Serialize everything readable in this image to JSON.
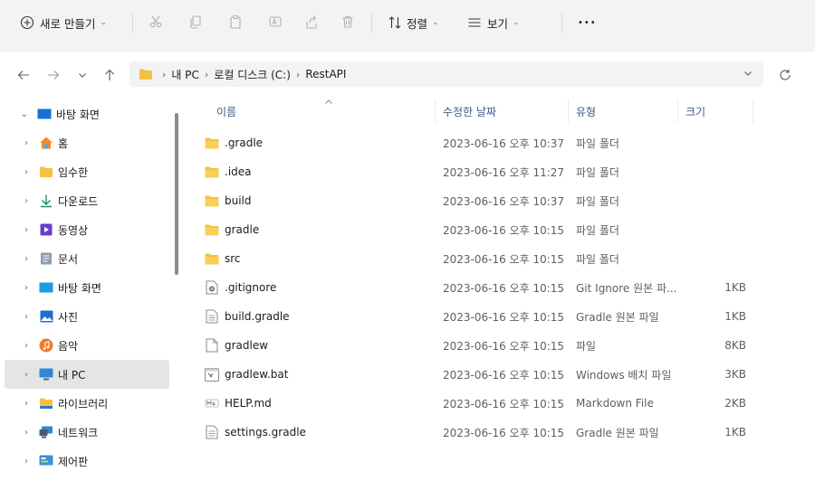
{
  "toolbar": {
    "new_label": "새로 만들기",
    "sort_label": "정렬",
    "view_label": "보기",
    "more_label": "•••"
  },
  "address": {
    "crumbs": [
      "내 PC",
      "로컬 디스크 (C:)",
      "RestAPI"
    ]
  },
  "sidebar": {
    "items": [
      {
        "label": "바탕 화면",
        "icon": "desktop-icon",
        "expanded": true
      },
      {
        "label": "홈",
        "icon": "home-icon"
      },
      {
        "label": "임수한",
        "icon": "folder-icon"
      },
      {
        "label": "다운로드",
        "icon": "download-icon"
      },
      {
        "label": "동영상",
        "icon": "video-icon"
      },
      {
        "label": "문서",
        "icon": "document-icon"
      },
      {
        "label": "바탕 화면",
        "icon": "desktop-icon"
      },
      {
        "label": "사진",
        "icon": "picture-icon"
      },
      {
        "label": "음악",
        "icon": "music-icon"
      },
      {
        "label": "내 PC",
        "icon": "pc-icon",
        "selected": true
      },
      {
        "label": "라이브러리",
        "icon": "library-icon"
      },
      {
        "label": "네트워크",
        "icon": "network-icon"
      },
      {
        "label": "제어판",
        "icon": "control-panel-icon"
      }
    ]
  },
  "columns": {
    "name": "이름",
    "date": "수정한 날짜",
    "type": "유형",
    "size": "크기"
  },
  "files": [
    {
      "name": ".gradle",
      "date": "2023-06-16 오후 10:37",
      "type": "파일 폴더",
      "size": "",
      "icon": "folder-icon"
    },
    {
      "name": ".idea",
      "date": "2023-06-16 오후 11:27",
      "type": "파일 폴더",
      "size": "",
      "icon": "folder-icon"
    },
    {
      "name": "build",
      "date": "2023-06-16 오후 10:37",
      "type": "파일 폴더",
      "size": "",
      "icon": "folder-icon"
    },
    {
      "name": "gradle",
      "date": "2023-06-16 오후 10:15",
      "type": "파일 폴더",
      "size": "",
      "icon": "folder-icon"
    },
    {
      "name": "src",
      "date": "2023-06-16 오후 10:15",
      "type": "파일 폴더",
      "size": "",
      "icon": "folder-icon"
    },
    {
      "name": ".gitignore",
      "date": "2023-06-16 오후 10:15",
      "type": "Git Ignore 원본 파...",
      "size": "1KB",
      "icon": "gitignore-file-icon"
    },
    {
      "name": "build.gradle",
      "date": "2023-06-16 오후 10:15",
      "type": "Gradle 원본 파일",
      "size": "1KB",
      "icon": "text-file-icon"
    },
    {
      "name": "gradlew",
      "date": "2023-06-16 오후 10:15",
      "type": "파일",
      "size": "8KB",
      "icon": "blank-file-icon"
    },
    {
      "name": "gradlew.bat",
      "date": "2023-06-16 오후 10:15",
      "type": "Windows 배치 파일",
      "size": "3KB",
      "icon": "batch-file-icon"
    },
    {
      "name": "HELP.md",
      "date": "2023-06-16 오후 10:15",
      "type": "Markdown File",
      "size": "2KB",
      "icon": "markdown-file-icon"
    },
    {
      "name": "settings.gradle",
      "date": "2023-06-16 오후 10:15",
      "type": "Gradle 원본 파일",
      "size": "1KB",
      "icon": "text-file-icon"
    }
  ],
  "colors": {
    "folder": "#f4c142",
    "accent": "#0a64c8",
    "selection": "#e5e5e5",
    "toolbar_bg": "#f3f3f3"
  }
}
